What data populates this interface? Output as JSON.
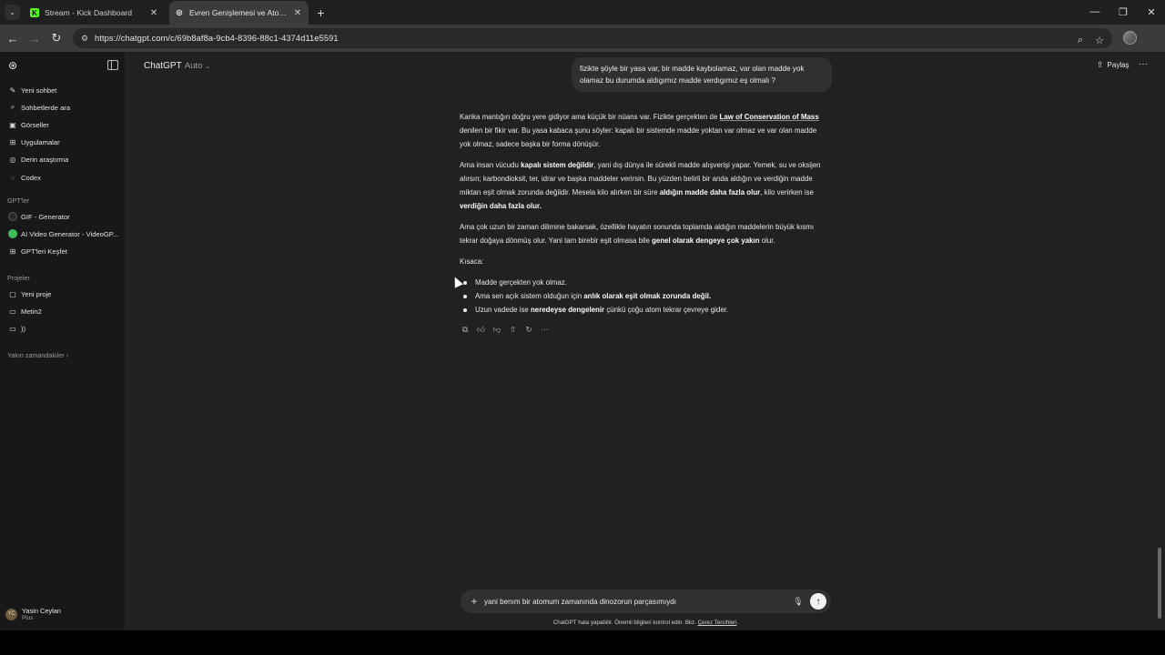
{
  "browser": {
    "tabs": [
      {
        "title": "Stream - Kick Dashboard",
        "favicon": "kick-logo",
        "favicon_color": "#53fc18"
      },
      {
        "title": "Evren Genişlemesi ve Atom Yaşı",
        "favicon": "chatgpt-logo",
        "active": true
      }
    ],
    "url": "https://chatgpt.com/c/69b8af8a-9cb4-8396-88c1-4374d11e5591"
  },
  "sidebar": {
    "primary": [
      {
        "icon": "new-chat-icon",
        "label": "Yeni sohbet"
      },
      {
        "icon": "search-icon",
        "label": "Sohbetlerde ara"
      },
      {
        "icon": "image-icon",
        "label": "Görseller"
      },
      {
        "icon": "apps-icon",
        "label": "Uygulamalar"
      },
      {
        "icon": "deep-research-icon",
        "label": "Derin araştırma"
      },
      {
        "icon": "codex-icon",
        "label": "Codex"
      }
    ],
    "gpts_heading": "GPT'ler",
    "gpts": [
      {
        "icon": "gif-generator-icon",
        "label": "GIF - Generator"
      },
      {
        "icon": "video-generator-icon",
        "label": "AI Video Generator - VideoGP..."
      },
      {
        "icon": "explore-gpts-icon",
        "label": "GPT'leri Keşfet"
      }
    ],
    "projects_heading": "Projeler",
    "projects": [
      {
        "icon": "new-project-icon",
        "label": "Yeni proje"
      },
      {
        "icon": "folder-icon",
        "label": "Metin2"
      },
      {
        "icon": "folder-icon",
        "label": "))"
      }
    ],
    "recents_label": "Yakın zamandakiler",
    "user": {
      "name": "Yasin Ceylan",
      "plan": "Plus",
      "initials": "YC"
    }
  },
  "header": {
    "model": "ChatGPT",
    "mode": "Auto",
    "share_label": "Paylaş"
  },
  "conversation": {
    "user_message": "fizikte şöyle bir yasa var, bir madde kaybolamaz, var olan madde yok olamaz bu durumda aldıgımız madde verdıgımız eş olmalı ?",
    "p1_a": "Kanka mantığın doğru yere gidiyor ama küçük bir nüans var. Fizikte gerçekten de ",
    "p1_b": "Law of Conservation of Mass",
    "p1_c": " denilen bir fikir var. Bu yasa kabaca şunu söyler: kapalı bir sistemde madde yoktan var olmaz ve var olan madde yok olmaz, sadece başka bir forma dönüşür.",
    "p2_a": "Ama insan vücudu ",
    "p2_b": "kapalı sistem değildir",
    "p2_c": ", yani dış dünya ile sürekli madde alışverişi yapar. Yemek, su ve oksijen alırsın; karbondioksit, ter, idrar ve başka maddeler verirsin. Bu yüzden belirli bir anda aldığın ve verdiğin madde miktarı eşit olmak zorunda değildir. Mesela kilo alırken bir süre ",
    "p2_d": "aldığın madde daha fazla olur",
    "p2_e": ", kilo verirken ise ",
    "p2_f": "verdiğin daha fazla olur.",
    "p3_a": "Ama çok uzun bir zaman dilimine bakarsak, özellikle hayatın sonunda toplamda aldığın maddelerin büyük kısmı tekrar doğaya dönmüş olur. Yani tam birebir eşit olmasa bile ",
    "p3_b": "genel olarak dengeye çok yakın",
    "p3_c": " olur.",
    "summary_label": "Kısaca:",
    "bullets": {
      "b1": "Madde gerçekten yok olmaz.",
      "b2_a": "Ama sen açık sistem olduğun için ",
      "b2_b": "anlık olarak eşit olmak zorunda değil.",
      "b3_a": "Uzun vadede ise ",
      "b3_b": "neredeyse dengelenir",
      "b3_c": " çünkü çoğu atom tekrar çevreye gider."
    }
  },
  "composer": {
    "value": "yani benım bir atomum zamanında dinozorun parçasımıydı",
    "disclaimer_text": "ChatGPT hata yapabilir. Önemli bilgileri kontrol edin. Bkz. ",
    "disclaimer_link": "Çerez Tercihleri",
    "disclaimer_end": "."
  }
}
